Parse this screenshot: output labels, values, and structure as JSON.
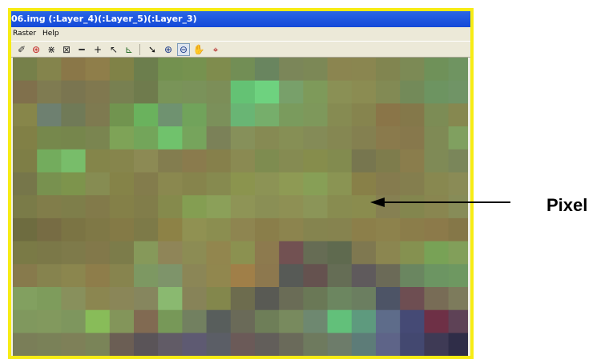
{
  "window": {
    "title": "06.img (:Layer_4)(:Layer_5)(:Layer_3)",
    "border_color": "#f7ec14",
    "title_color": "#1a55dd"
  },
  "menu": {
    "items": [
      "Raster",
      "Help"
    ]
  },
  "toolbar": {
    "tools": [
      {
        "icon": "eraser-icon",
        "glyph": "✐"
      },
      {
        "icon": "red-circle-icon",
        "glyph": "⊛"
      },
      {
        "icon": "shrink-arrows-icon",
        "glyph": "⋇"
      },
      {
        "icon": "expand-box-icon",
        "glyph": "⊠"
      },
      {
        "icon": "minus-icon",
        "glyph": "━"
      },
      {
        "icon": "crosshair-icon",
        "glyph": "+"
      },
      {
        "icon": "pointer-select-icon",
        "glyph": "↖"
      },
      {
        "icon": "chart-icon",
        "glyph": "⊾"
      },
      {
        "icon": "arrow-cursor-icon",
        "glyph": "➘"
      },
      {
        "icon": "zoom-in-icon",
        "glyph": "⊕"
      },
      {
        "icon": "zoom-out-icon",
        "glyph": "⊖"
      },
      {
        "icon": "pan-hand-icon",
        "glyph": "✋"
      },
      {
        "icon": "inquire-icon",
        "glyph": "⌖"
      }
    ]
  },
  "annotation": {
    "label": "Pixel"
  },
  "raster": {
    "rows": [
      [
        "#76804a",
        "#84844c",
        "#8a7748",
        "#8f7e4a",
        "#808247",
        "#6c7e4d",
        "#73914f",
        "#76924f",
        "#7f8c4d",
        "#728e55",
        "#69855f",
        "#7b8659",
        "#7c8856",
        "#8b8550",
        "#8a8650",
        "#818550",
        "#7c8a55",
        "#6f9159",
        "#6f9461"
      ],
      [
        "#80704c",
        "#7f7b51",
        "#7a7550",
        "#80784f",
        "#788051",
        "#6f7b4d",
        "#799458",
        "#7a925a",
        "#7c8e58",
        "#64c274",
        "#6ed27f",
        "#78a06a",
        "#7e9a5a",
        "#8a9055",
        "#8b8c52",
        "#828a54",
        "#738a59",
        "#6d9461",
        "#709466"
      ],
      [
        "#87864a",
        "#6e8070",
        "#707a57",
        "#7e7a50",
        "#71944f",
        "#6ab25d",
        "#6f9270",
        "#71a35b",
        "#7b905a",
        "#69b574",
        "#76ae6b",
        "#7a9b5d",
        "#7e985b",
        "#868b52",
        "#86844e",
        "#8a7548",
        "#84784a",
        "#7c8c55",
        "#868850"
      ],
      [
        "#818046",
        "#76884c",
        "#76864c",
        "#7a8550",
        "#7ea357",
        "#73a55a",
        "#70c26c",
        "#76a45c",
        "#7b8158",
        "#86905a",
        "#868a53",
        "#868f55",
        "#848b57",
        "#858752",
        "#848050",
        "#8a7a4c",
        "#87784c",
        "#7f8a55",
        "#80a060"
      ],
      [
        "#7e7e46",
        "#73ac5d",
        "#78bd6a",
        "#84854a",
        "#86854c",
        "#8c8a54",
        "#837d4f",
        "#8a7b4d",
        "#86804b",
        "#8a8a52",
        "#7e8c50",
        "#858b52",
        "#868d4c",
        "#828b4f",
        "#77764f",
        "#7e7c4c",
        "#8a7d4c",
        "#7f8a56",
        "#7a865a"
      ],
      [
        "#76764a",
        "#78914f",
        "#7d944c",
        "#868c52",
        "#858348",
        "#837c4c",
        "#8a884f",
        "#86844c",
        "#868a4f",
        "#8b944e",
        "#8c9355",
        "#8e9a54",
        "#879f56",
        "#8a9453",
        "#888048",
        "#857b4e",
        "#847e4e",
        "#888850",
        "#8a8b56"
      ],
      [
        "#7a7b48",
        "#817d4a",
        "#7e7e4a",
        "#827a4a",
        "#848048",
        "#817d4a",
        "#858a4c",
        "#849e52",
        "#8ba059",
        "#8e9456",
        "#8a8f55",
        "#8e9054",
        "#8b9558",
        "#888c50",
        "#8a8c4e",
        "#868052",
        "#83864e",
        "#898650",
        "#878c58"
      ],
      [
        "#6e6c40",
        "#776c44",
        "#7b7444",
        "#7f7846",
        "#847a46",
        "#7d7a48",
        "#8d8246",
        "#909152",
        "#8b8e50",
        "#8e8550",
        "#8a7e4a",
        "#8c844e",
        "#85844f",
        "#86834f",
        "#8c7f4a",
        "#8d824c",
        "#8b7d4a",
        "#8c7a4a",
        "#857748"
      ],
      [
        "#7a7a46",
        "#7b7848",
        "#7e7a4a",
        "#82784a",
        "#7c7c4a",
        "#86995a",
        "#8f8558",
        "#8c8c54",
        "#92864e",
        "#8b9150",
        "#8d7a4e",
        "#725152",
        "#666c54",
        "#5f6a4f",
        "#7f7850",
        "#8b8650",
        "#859150",
        "#78a256",
        "#829f5a"
      ],
      [
        "#877a4c",
        "#86834e",
        "#8b864e",
        "#8e7d4a",
        "#87844e",
        "#7d9862",
        "#7e946a",
        "#8b8656",
        "#91874e",
        "#a07f48",
        "#8d784e",
        "#575a56",
        "#65524f",
        "#656d55",
        "#5f5a5c",
        "#6b6a57",
        "#6a8660",
        "#6c9562",
        "#6e9861"
      ],
      [
        "#82a060",
        "#7e9c5c",
        "#88905c",
        "#8b8650",
        "#8a8658",
        "#86865e",
        "#8ab970",
        "#878358",
        "#83874c",
        "#6d6c4e",
        "#595a54",
        "#6a6c56",
        "#6a7856",
        "#6c8660",
        "#6b7e60",
        "#4d5466",
        "#6e4e52",
        "#786c56",
        "#7d7b5c"
      ],
      [
        "#80985e",
        "#82995e",
        "#7e965e",
        "#88bc59",
        "#83955a",
        "#816a52",
        "#779858",
        "#728060",
        "#585e5c",
        "#6a6a58",
        "#6e7e58",
        "#788a5e",
        "#6e8870",
        "#62c07a",
        "#5e9a7e",
        "#5e6c8a",
        "#454a75",
        "#6e3046",
        "#5e4256"
      ],
      [
        "#7a7e58",
        "#7a8158",
        "#7e8058",
        "#7a8458",
        "#6b5e54",
        "#5a5458",
        "#615b66",
        "#5e5a72",
        "#5b5e66",
        "#6b5a58",
        "#625e5a",
        "#6a6a5a",
        "#6e7a5e",
        "#6d7c6a",
        "#5d7c78",
        "#5e6488",
        "#434870",
        "#3e3a55",
        "#2f2d48"
      ]
    ]
  }
}
